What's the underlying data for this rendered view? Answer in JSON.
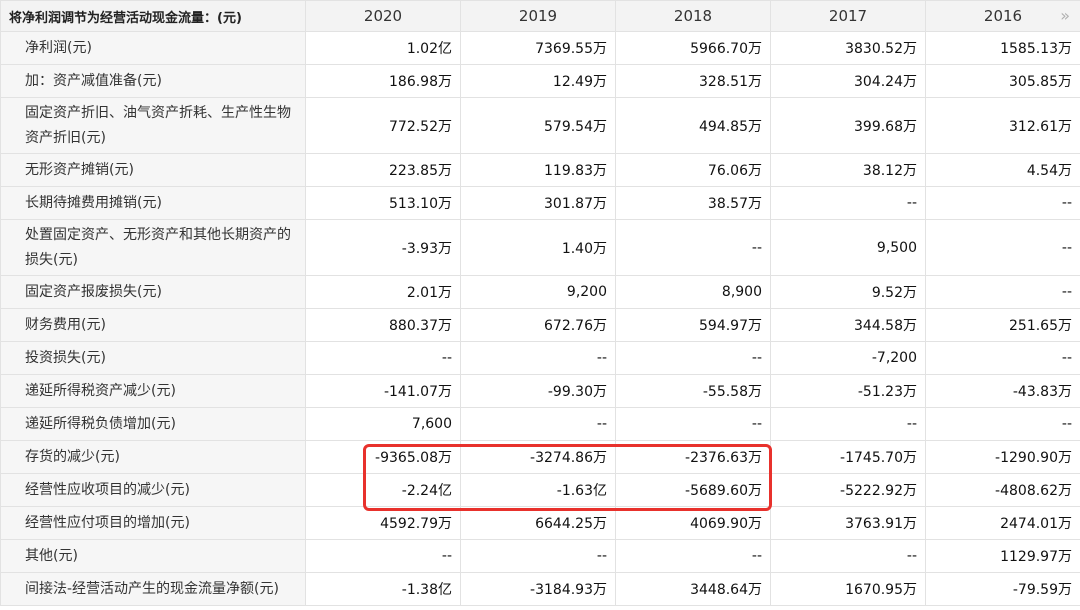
{
  "header": {
    "label": "将净利润调节为经营活动现金流量：(元)",
    "years": [
      "2020",
      "2019",
      "2018",
      "2017",
      "2016"
    ],
    "more_icon": "double-chevron-right-icon"
  },
  "rows": [
    {
      "label": "净利润(元)",
      "values": [
        "1.02亿",
        "7369.55万",
        "5966.70万",
        "3830.52万",
        "1585.13万"
      ]
    },
    {
      "label": "加：资产减值准备(元)",
      "values": [
        "186.98万",
        "12.49万",
        "328.51万",
        "304.24万",
        "305.85万"
      ]
    },
    {
      "label": "固定资产折旧、油气资产折耗、生产性生物资产折旧(元)",
      "values": [
        "772.52万",
        "579.54万",
        "494.85万",
        "399.68万",
        "312.61万"
      ]
    },
    {
      "label": "无形资产摊销(元)",
      "values": [
        "223.85万",
        "119.83万",
        "76.06万",
        "38.12万",
        "4.54万"
      ]
    },
    {
      "label": "长期待摊费用摊销(元)",
      "values": [
        "513.10万",
        "301.87万",
        "38.57万",
        "--",
        "--"
      ]
    },
    {
      "label": "处置固定资产、无形资产和其他长期资产的损失(元)",
      "values": [
        "-3.93万",
        "1.40万",
        "--",
        "9,500",
        "--"
      ]
    },
    {
      "label": "固定资产报废损失(元)",
      "values": [
        "2.01万",
        "9,200",
        "8,900",
        "9.52万",
        "--"
      ]
    },
    {
      "label": "财务费用(元)",
      "values": [
        "880.37万",
        "672.76万",
        "594.97万",
        "344.58万",
        "251.65万"
      ]
    },
    {
      "label": "投资损失(元)",
      "values": [
        "--",
        "--",
        "--",
        "-7,200",
        "--"
      ]
    },
    {
      "label": "递延所得税资产减少(元)",
      "values": [
        "-141.07万",
        "-99.30万",
        "-55.58万",
        "-51.23万",
        "-43.83万"
      ]
    },
    {
      "label": "递延所得税负债增加(元)",
      "values": [
        "7,600",
        "--",
        "--",
        "--",
        "--"
      ]
    },
    {
      "label": "存货的减少(元)",
      "values": [
        "-9365.08万",
        "-3274.86万",
        "-2376.63万",
        "-1745.70万",
        "-1290.90万"
      ]
    },
    {
      "label": "经营性应收项目的减少(元)",
      "values": [
        "-2.24亿",
        "-1.63亿",
        "-5689.60万",
        "-5222.92万",
        "-4808.62万"
      ]
    },
    {
      "label": "经营性应付项目的增加(元)",
      "values": [
        "4592.79万",
        "6644.25万",
        "4069.90万",
        "3763.91万",
        "2474.01万"
      ]
    },
    {
      "label": "其他(元)",
      "values": [
        "--",
        "--",
        "--",
        "--",
        "1129.97万"
      ]
    },
    {
      "label": "间接法-经营活动产生的现金流量净额(元)",
      "values": [
        "-1.38亿",
        "-3184.93万",
        "3448.64万",
        "1670.95万",
        "-79.59万"
      ]
    }
  ],
  "colors": {
    "highlight": "#e8312c",
    "header_bg": "#f3f3f3",
    "label_bg": "#f6f6f6"
  }
}
